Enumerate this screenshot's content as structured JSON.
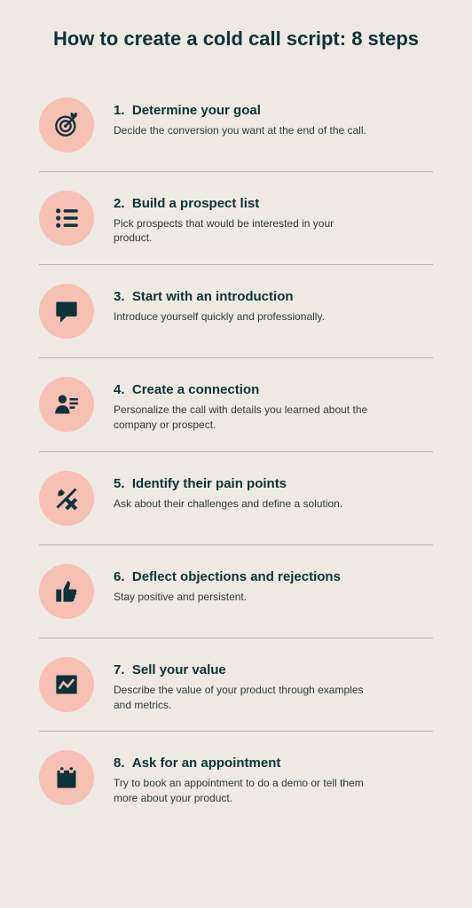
{
  "title": "How to create a cold call script: 8 steps",
  "steps": [
    {
      "num": "1.",
      "heading": "Determine your goal",
      "desc": "Decide the conversion you want at the end of the call.",
      "icon": "target"
    },
    {
      "num": "2.",
      "heading": "Build a prospect list",
      "desc": "Pick prospects that would be interested in your product.",
      "icon": "list"
    },
    {
      "num": "3.",
      "heading": "Start with an introduction",
      "desc": "Introduce yourself quickly and professionally.",
      "icon": "chat"
    },
    {
      "num": "4.",
      "heading": "Create a connection",
      "desc": "Personalize the call with details you learned about the company or prospect.",
      "icon": "person"
    },
    {
      "num": "5.",
      "heading": "Identify their pain points",
      "desc": "Ask about their challenges and define a solution.",
      "icon": "slash"
    },
    {
      "num": "6.",
      "heading": "Deflect objections and rejections",
      "desc": "Stay positive and persistent.",
      "icon": "thumb"
    },
    {
      "num": "7.",
      "heading": "Sell your value",
      "desc": "Describe the value of your product through examples and metrics.",
      "icon": "chart"
    },
    {
      "num": "8.",
      "heading": "Ask for an appointment",
      "desc": "Try to book an appointment to do a demo or tell them more about your product.",
      "icon": "calendar"
    }
  ]
}
